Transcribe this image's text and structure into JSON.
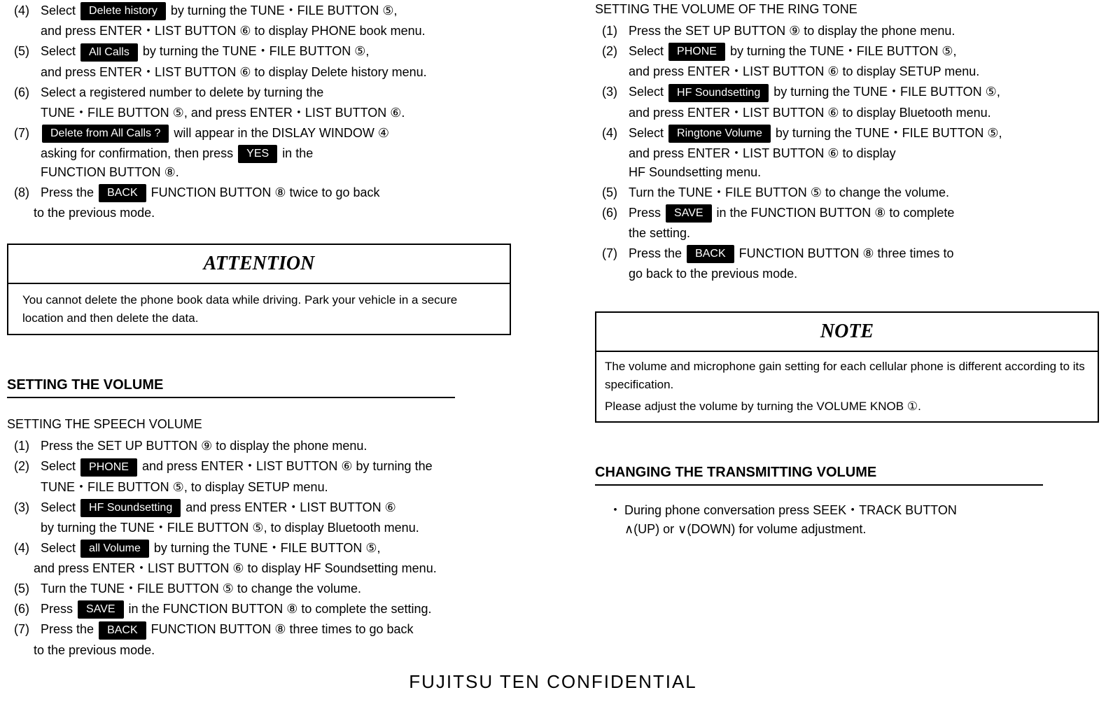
{
  "left": {
    "s4": {
      "num": "(4)",
      "a": "Select",
      "btn": "Delete history",
      "b": "by turning the TUNE・FILE BUTTON ⑤,",
      "c": "and press ENTER・LIST BUTTON ⑥ to display PHONE book menu."
    },
    "s5": {
      "num": "(5)",
      "a": "Select",
      "btn": "All Calls",
      "b": "by turning the TUNE・FILE BUTTON ⑤,",
      "c": "and press ENTER・LIST BUTTON ⑥ to display Delete history menu."
    },
    "s6": {
      "num": "(6)",
      "a": "Select a registered number to delete by turning the",
      "b": "TUNE・FILE BUTTON ⑤, and press ENTER・LIST BUTTON ⑥."
    },
    "s7": {
      "num": "(7)",
      "btn": "Delete from All Calls ?",
      "a": "will appear in the DISLAY WINDOW ④",
      "b": "asking for confirmation, then press",
      "btn2": "YES",
      "c": "in the",
      "d": "FUNCTION BUTTON ⑧."
    },
    "s8": {
      "num": "(8)",
      "a": "Press the",
      "btn": "BACK",
      "b": "FUNCTION BUTTON ⑧ twice to go back",
      "c": "to the previous mode."
    },
    "attention_title": "ATTENTION",
    "attention_body": "You cannot delete the phone book data while driving. Park your vehicle in a secure location and then delete the data.",
    "vol_h": "SETTING THE VOLUME",
    "speech_h": "SETTING THE SPEECH VOLUME",
    "v1": {
      "num": "(1)",
      "a": "Press the SET UP BUTTON ⑨ to display the phone menu."
    },
    "v2": {
      "num": "(2)",
      "a": "Select",
      "btn": "PHONE",
      "b": "and press ENTER・LIST BUTTON ⑥ by turning the",
      "c": "TUNE・FILE BUTTON ⑤, to display SETUP menu."
    },
    "v3": {
      "num": "(3)",
      "a": "Select",
      "btn": "HF Soundsetting",
      "b": "and press ENTER・LIST BUTTON ⑥",
      "c": "by turning the TUNE・FILE BUTTON ⑤, to display Bluetooth menu."
    },
    "v4": {
      "num": "(4)",
      "a": "Select",
      "btn": "all Volume",
      "b": "by turning the TUNE・FILE BUTTON ⑤,",
      "c": "and press ENTER・LIST BUTTON ⑥ to display HF Soundsetting menu."
    },
    "v5": {
      "num": "(5)",
      "a": "Turn the TUNE・FILE BUTTON ⑤ to change the volume."
    },
    "v6": {
      "num": "(6)",
      "a": "Press",
      "btn": "SAVE",
      "b": "in the FUNCTION BUTTON ⑧ to complete the setting."
    },
    "v7": {
      "num": "(7)",
      "a": "Press the",
      "btn": "BACK",
      "b": "FUNCTION BUTTON ⑧ three times to go back",
      "c": "to the previous mode."
    }
  },
  "right": {
    "ring_h": "SETTING THE VOLUME OF THE RING TONE",
    "r1": {
      "num": "(1)",
      "a": "Press the SET UP BUTTON ⑨ to display the phone menu."
    },
    "r2": {
      "num": "(2)",
      "a": "Select",
      "btn": "PHONE",
      "b": "by turning the TUNE・FILE BUTTON ⑤,",
      "c": "and press ENTER・LIST BUTTON ⑥ to display SETUP menu."
    },
    "r3": {
      "num": "(3)",
      "a": "Select",
      "btn": "HF Soundsetting",
      "b": "by turning the TUNE・FILE BUTTON ⑤,",
      "c": "and press ENTER・LIST BUTTON ⑥ to display Bluetooth menu."
    },
    "r4": {
      "num": "(4)",
      "a": "Select",
      "btn": "Ringtone Volume",
      "b": "by turning the TUNE・FILE BUTTON ⑤,",
      "c": "and press ENTER・LIST BUTTON ⑥ to display",
      "d": "HF Soundsetting menu."
    },
    "r5": {
      "num": "(5)",
      "a": "Turn the TUNE・FILE BUTTON ⑤ to change the volume."
    },
    "r6": {
      "num": "(6)",
      "a": "Press",
      "btn": "SAVE",
      "b": "in the FUNCTION BUTTON ⑧ to complete",
      "c": "the setting."
    },
    "r7": {
      "num": "(7)",
      "a": "Press the",
      "btn": "BACK",
      "b": "FUNCTION BUTTON ⑧ three times to",
      "c": "go back to the previous mode."
    },
    "note_title": "NOTE",
    "note_body1": "The volume and microphone gain setting for each cellular phone is different according to its specification.",
    "note_body2": "Please adjust the volume by turning the VOLUME  KNOB ①.",
    "trans_h": "CHANGING THE TRANSMITTING VOLUME",
    "trans_bullet": "・",
    "trans_a": "During phone conversation press SEEK・TRACK BUTTON",
    "trans_b": "∧(UP) or ∨(DOWN) for volume adjustment."
  },
  "footer": "FUJITSU TEN CONFIDENTIAL"
}
